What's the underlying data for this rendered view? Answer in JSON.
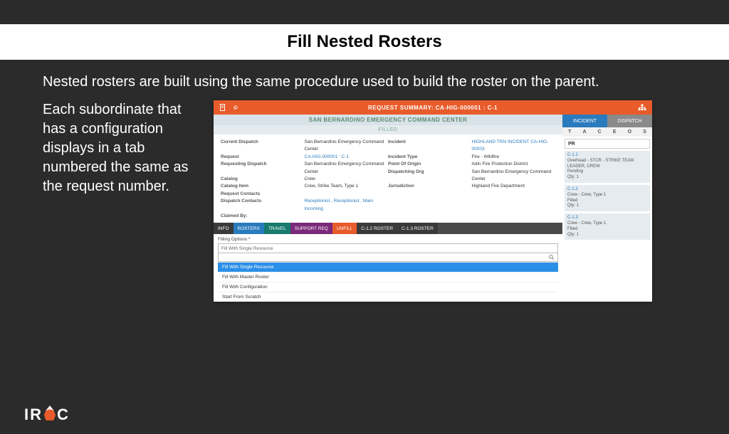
{
  "slide": {
    "title": "Fill Nested Rosters",
    "para1": "Nested rosters are built using the same procedure used to build the roster on the parent.",
    "para2": "Each subordinate that has a configuration displays in a tab numbered the same as the request number.",
    "logo_left": "IR",
    "logo_right": "C"
  },
  "app": {
    "header_label": "REQUEST SUMMARY: CA-HIG-000001 : C-1",
    "center_name": "SAN BERNARDINO EMERGENCY COMMAND CENTER",
    "status": "FILLED",
    "labels": {
      "current_dispatch": "Current Dispatch",
      "request": "Request",
      "requesting_dispatch": "Requesting Dispatch",
      "catalog": "Catalog",
      "catalog_item": "Catalog Item",
      "request_contacts": "Request Contacts",
      "dispatch_contacts": "Dispatch Contacts",
      "claimed_by": "Claimed By:",
      "incident": "Incident",
      "incident_type": "Incident Type",
      "point_of_origin": "Point Of Origin",
      "dispatching_org": "Dispatching Org",
      "jurisdiction": "Jurisdiction"
    },
    "values": {
      "current_dispatch": "San Bernardino Emergency Command Center",
      "request": "CA-HIG-000001 : C-1",
      "requesting_dispatch": "San Bernardino Emergency Command Center",
      "catalog": "Crew",
      "catalog_item": "Crew, Strike Team, Type 1",
      "dispatch_contacts": "Receptionist , Receptionist , Main Incoming",
      "incident": "HIGHLAND TRN INCIDENT CA-HIG-00003",
      "incident_type": "Fire - Wildfire",
      "point_of_origin": "Adin Fire Protection District",
      "dispatching_org": "San Bernardino Emergency Command Center",
      "jurisdiction": "Highland Fire Department"
    },
    "tabs": {
      "info": "INFO",
      "rosters": "ROSTERS",
      "travel": "TRAVEL",
      "support_req": "SUPPORT REQ",
      "unfill": "UNFILL",
      "roster12": "C-1.2 ROSTER",
      "roster13": "C-1.3 ROSTER"
    },
    "fill": {
      "label": "Filling Options *",
      "selected": "Fill With Single Resource",
      "options": [
        "Fill With Single Resource",
        "Fill With Master Roster",
        "Fill With Configuration",
        "Start From Scratch"
      ]
    },
    "sidebar": {
      "tab_incident": "INCIDENT",
      "tab_dispatch": "DISPATCH",
      "iconrow": [
        "T",
        "A",
        "C",
        "E",
        "O",
        "S"
      ],
      "pr": "PR",
      "items": [
        {
          "id": "C-1.1",
          "desc": "Overhead - STCR - STRIKE TEAM LEADER, CREW",
          "status": "Pending",
          "qty": "Qty: 1"
        },
        {
          "id": "C-1.2",
          "desc": "Crew - Crew, Type 1",
          "status": "Filled",
          "qty": "Qty: 1"
        },
        {
          "id": "C-1.3",
          "desc": "Crew - Crew, Type 1",
          "status": "Filled",
          "qty": "Qty: 1"
        }
      ]
    }
  }
}
